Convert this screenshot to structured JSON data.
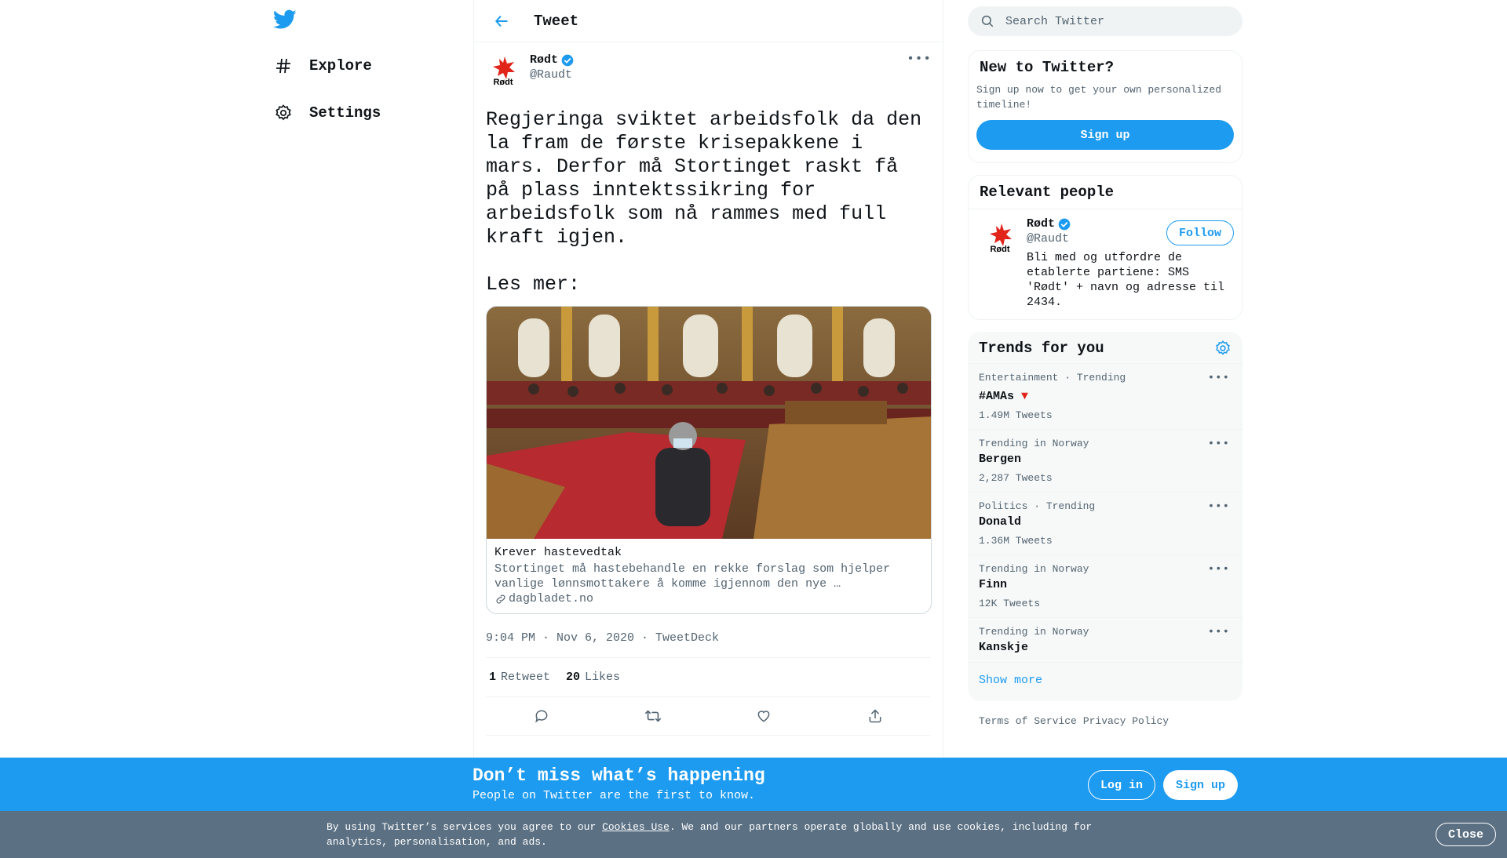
{
  "nav": {
    "explore_label": "Explore",
    "settings_label": "Settings"
  },
  "header": {
    "title": "Tweet"
  },
  "tweet": {
    "author_name": "Rødt",
    "author_handle": "@Raudt",
    "avatar_text": "Rødt",
    "text": "Regjeringa sviktet arbeidsfolk da den la fram de første krisepakkene i mars. Derfor må Stortinget raskt få på plass inntektssikring for arbeidsfolk som nå rammes med full kraft igjen.\n\nLes mer:",
    "card": {
      "title": "Krever hastevedtak",
      "description": "Stortinget må hastebehandle en rekke forslag som hjelper vanlige lønnsmottakere å komme igjennom den nye …",
      "domain": "dagbladet.no"
    },
    "time": "9:04 PM · Nov 6, 2020",
    "source_sep": " · ",
    "source": "TweetDeck",
    "retweets_count": "1",
    "retweets_label": "Retweet",
    "likes_count": "20",
    "likes_label": "Likes"
  },
  "search": {
    "placeholder": "Search Twitter"
  },
  "new_to_twitter": {
    "title": "New to Twitter?",
    "blurb": "Sign up now to get your own personalized timeline!",
    "button": "Sign up"
  },
  "relevant_people": {
    "title": "Relevant people",
    "name": "Rødt",
    "handle": "@Raudt",
    "follow_label": "Follow",
    "bio": "Bli med og utfordre de etablerte partiene: SMS 'Rødt' + navn og adresse til 2434."
  },
  "trends": {
    "title": "Trends for you",
    "items": [
      {
        "context": "Entertainment · Trending",
        "name": "#AMAs",
        "count": "1.49M Tweets"
      },
      {
        "context": "Trending in Norway",
        "name": "Bergen",
        "count": "2,287 Tweets"
      },
      {
        "context": "Politics · Trending",
        "name": "Donald",
        "count": "1.36M Tweets"
      },
      {
        "context": "Trending in Norway",
        "name": "Finn",
        "count": "12K Tweets"
      },
      {
        "context": "Trending in Norway",
        "name": "Kanskje",
        "count": ""
      }
    ],
    "show_more": "Show more"
  },
  "footer": {
    "terms": "Terms of Service",
    "privacy": "Privacy Policy"
  },
  "banner": {
    "title": "Don’t miss what’s happening",
    "subtitle": "People on Twitter are the first to know.",
    "login": "Log in",
    "signup": "Sign up"
  },
  "cookie": {
    "text_before": "By using Twitter’s services you agree to our ",
    "link": "Cookies Use",
    "text_after": ". We and our partners operate globally and use cookies, including for analytics, personalisation, and ads.",
    "close": "Close"
  },
  "colors": {
    "accent": "#1d9bf0",
    "party_red": "#e1251b",
    "cookie_bg": "#5b7083"
  }
}
